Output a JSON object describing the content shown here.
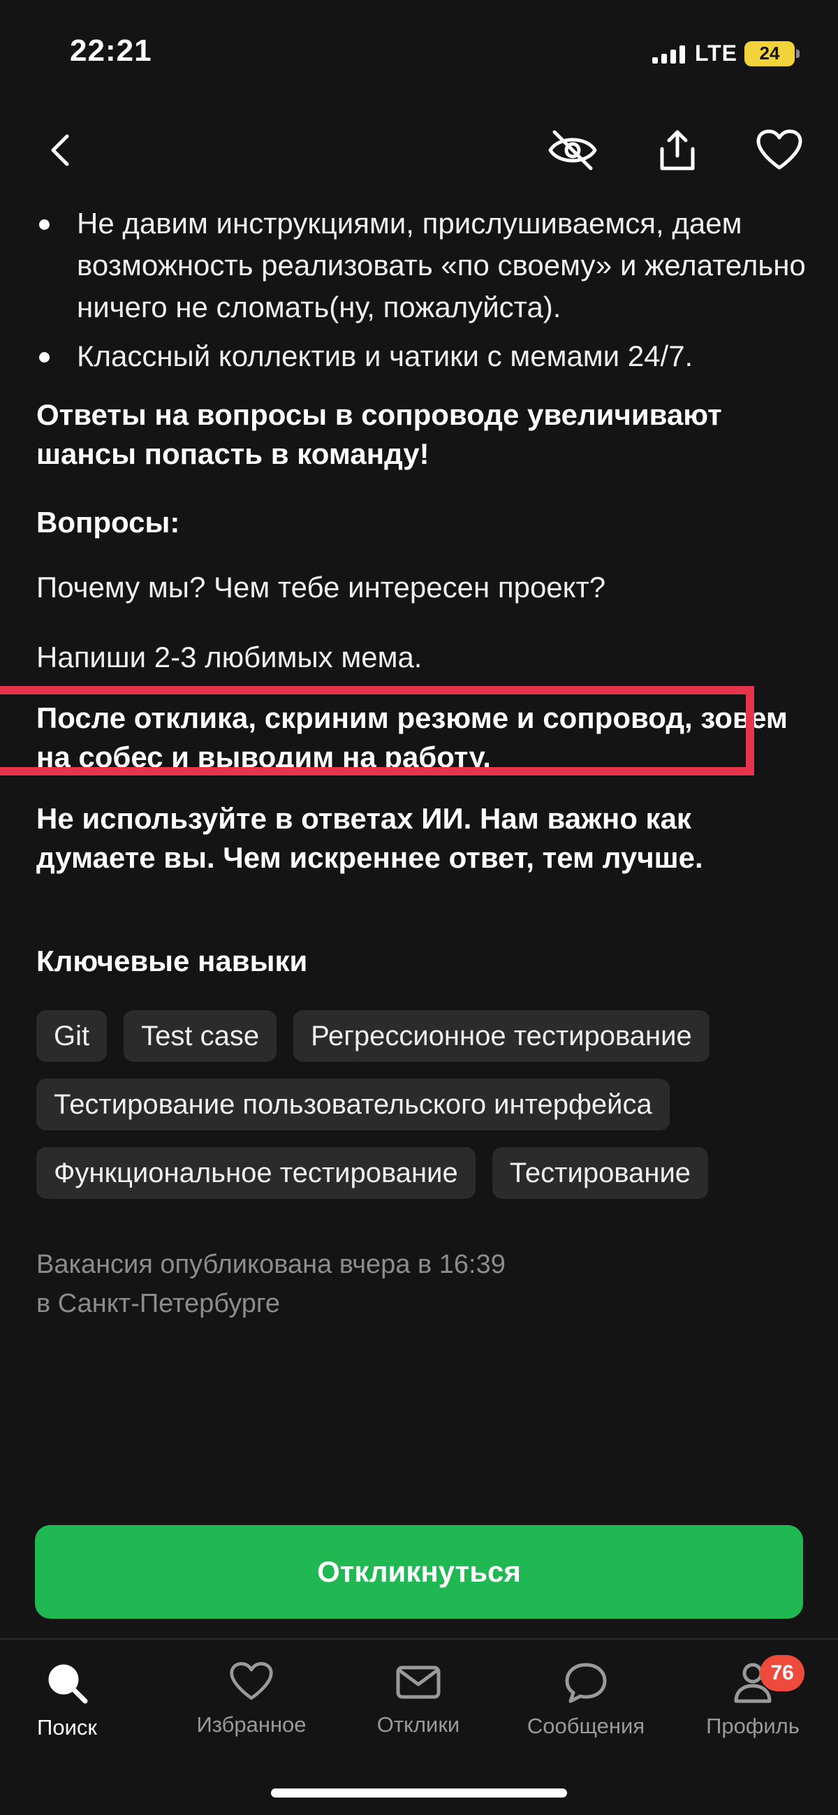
{
  "status_bar": {
    "time": "22:21",
    "network": "LTE",
    "battery": "24"
  },
  "top_nav": {
    "back_icon": "chevron-left-icon",
    "hide_icon": "eye-off-icon",
    "share_icon": "share-icon",
    "favorite_icon": "heart-icon"
  },
  "content": {
    "bullets": [
      "Не давим инструкциями, прислушиваемся, даем возможность реализовать «по своему» и желательно ничего не сломать(ну, пожалуйста).",
      "Классный коллектив и чатики с мемами 24/7."
    ],
    "cover_letter_note": "Ответы на вопросы в сопроводе увеличивают шансы попасть в команду!",
    "questions_title": "Вопросы:",
    "question_1": "Почему мы? Чем тебе интересен проект?",
    "question_2": "Напиши 2-3 любимых мема.",
    "after_apply": "После отклика, скриним резюме и сопровод, зовем на собес и выводим на работу.",
    "no_ai": "Не используйте в ответах ИИ. Нам важно как думаете вы. Чем искреннее ответ, тем лучше."
  },
  "skills": {
    "title": "Ключевые навыки",
    "items": [
      "Git",
      "Test case",
      "Регрессионное тестирование",
      "Тестирование пользовательского интерфейса",
      "Функциональное тестирование",
      "Тестирование"
    ]
  },
  "meta": {
    "published": "Вакансия опубликована вчера в 16:39",
    "location": "в Санкт-Петербурге"
  },
  "apply_button": "Откликнуться",
  "tabs": [
    {
      "label": "Поиск",
      "icon": "search-icon"
    },
    {
      "label": "Избранное",
      "icon": "heart-icon"
    },
    {
      "label": "Отклики",
      "icon": "envelope-icon"
    },
    {
      "label": "Сообщения",
      "icon": "chat-bubble-icon"
    },
    {
      "label": "Профиль",
      "icon": "person-icon",
      "badge": "76"
    }
  ],
  "colors": {
    "background": "#141414",
    "accent_green": "#1fb852",
    "highlight_red": "#e8334c",
    "badge_red": "#ee4b3c",
    "chip_bg": "#2b2b2b"
  }
}
